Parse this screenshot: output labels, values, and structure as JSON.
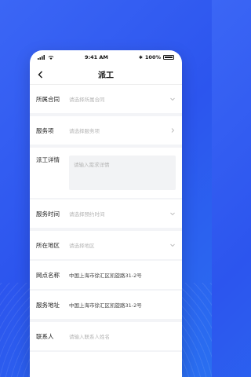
{
  "status": {
    "time": "9:41 AM",
    "battery": "100%"
  },
  "nav": {
    "title": "派工"
  },
  "form": {
    "contract": {
      "label": "所属合同",
      "placeholder": "请选择所属合同"
    },
    "service_item": {
      "label": "服务项",
      "placeholder": "请选择服务项"
    },
    "details": {
      "label": "派工详情",
      "placeholder": "请输入需求详情"
    },
    "service_time": {
      "label": "服务时间",
      "placeholder": "请选择预约时间"
    },
    "region": {
      "label": "所在地区",
      "placeholder": "请选择地区"
    },
    "outlet_name": {
      "label": "网点名称",
      "value": "中国上海市徐汇区凯旋路31-2号"
    },
    "service_address": {
      "label": "服务地址",
      "value": "中国上海市徐汇区凯旋路31-2号"
    },
    "contact": {
      "label": "联系人",
      "placeholder": "请输入联系人姓名"
    }
  },
  "icons": {
    "back": "back-arrow-icon",
    "dropdown": "chevron-down-icon",
    "next": "chevron-right-icon"
  }
}
